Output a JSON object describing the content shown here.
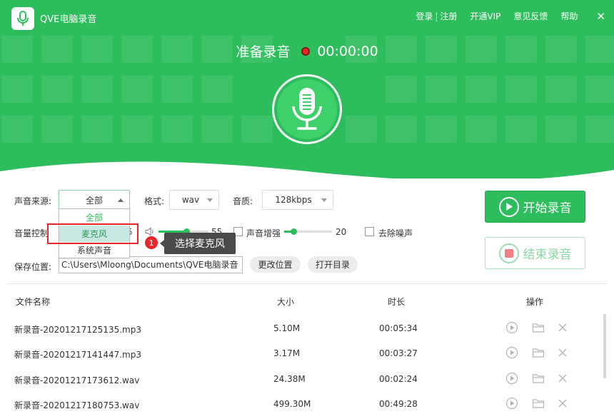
{
  "app": {
    "title": "QVE电脑录音"
  },
  "topnav": {
    "login": "登录",
    "separator": "|",
    "register": "注册",
    "vip": "开通VIP",
    "feedback": "意见反馈",
    "help": "帮助",
    "close": "✕"
  },
  "status": {
    "label": "准备录音",
    "time": "00:00:00"
  },
  "controls": {
    "source_label": "声音来源:",
    "source_value": "全部",
    "source_options": [
      "全部",
      "麦克风",
      "系统声音"
    ],
    "format_label": "格式:",
    "format_value": "wav",
    "quality_label": "音质:",
    "quality_value": "128kbps",
    "volume_label": "音量控制",
    "volume_value_partial": "5",
    "mic_volume_value": "55",
    "mic_volume_level": 0.55,
    "boost_label": "声音增强",
    "boost_value": "20",
    "boost_level": 0.2,
    "denoise_label": "去除噪声",
    "save_label": "保存位置:",
    "save_path": "C:\\Users\\Mloong\\Documents\\QVE电脑录音",
    "change_location": "更改位置",
    "open_dir": "打开目录"
  },
  "tooltip": {
    "badge": "1",
    "text": "选择麦克风"
  },
  "buttons": {
    "start": "开始录音",
    "stop": "结束录音"
  },
  "table": {
    "headers": {
      "name": "文件名称",
      "size": "大小",
      "duration": "时长",
      "actions": "操作"
    },
    "rows": [
      {
        "name": "新录音-20201217125135.mp3",
        "size": "5.10M",
        "duration": "00:05:34"
      },
      {
        "name": "新录音-20201217141447.mp3",
        "size": "3.17M",
        "duration": "00:03:27"
      },
      {
        "name": "新录音-20201217173612.wav",
        "size": "24.38M",
        "duration": "00:02:24"
      },
      {
        "name": "新录音-20201217180753.wav",
        "size": "499.30M",
        "duration": "00:49:28"
      }
    ]
  },
  "colors": {
    "brand": "#2dbd5c",
    "record_dot": "#e02b2b",
    "highlight": "#e8262b"
  }
}
